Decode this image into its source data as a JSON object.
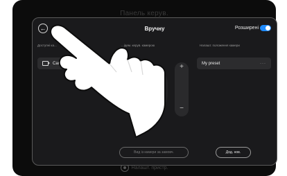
{
  "background": {
    "title": "Панель керув.",
    "bottom_label": "Налашт. пристр."
  },
  "panel": {
    "title": "Вручну",
    "advanced_label": "Розширені",
    "advanced_enabled": true,
    "sections": {
      "available_cameras": "Доступні ка...",
      "camera_control": "...ідем. керув. камерою",
      "camera_presets": "Налашт. положення камери"
    },
    "camera_name": "Camera",
    "preset_name": "My preset",
    "preset_menu": "···",
    "zoom_in": "+",
    "zoom_out": "−",
    "pan_arrow": "›",
    "view_button": "Вид із камери за замовч.",
    "add_button": "Дод. нов."
  },
  "colors": {
    "accent": "#1e8bff",
    "panel_bg": "#1a1a1c",
    "item_bg": "#2c2c2e"
  },
  "icons": [
    "back-arrow-icon",
    "camera-icon",
    "more-icon",
    "settings-gear-icon",
    "pointing-hand-icon"
  ]
}
